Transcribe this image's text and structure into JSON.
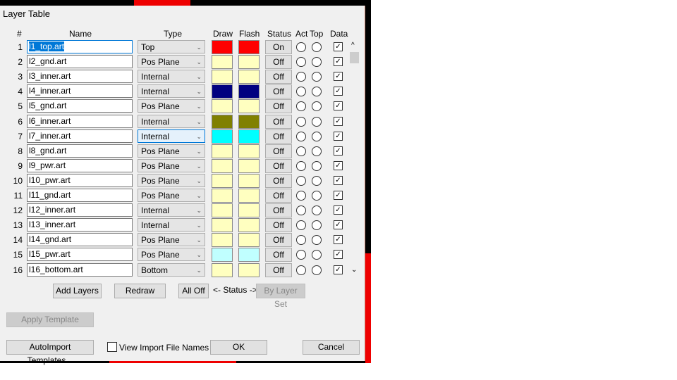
{
  "title": "Layer Table",
  "headers": {
    "num": "#",
    "name": "Name",
    "type": "Type",
    "draw": "Draw",
    "flash": "Flash",
    "status": "Status",
    "act": "Act",
    "top": "Top",
    "data": "Data"
  },
  "layers": [
    {
      "num": "1",
      "name": "l1_top.art",
      "type": "Top",
      "draw": "#ff0000",
      "flash": "#ff0000",
      "status": "On",
      "data": true
    },
    {
      "num": "2",
      "name": "l2_gnd.art",
      "type": "Pos Plane",
      "draw": "#ffffc0",
      "flash": "#ffffc0",
      "status": "Off",
      "data": true
    },
    {
      "num": "3",
      "name": "l3_inner.art",
      "type": "Internal",
      "draw": "#ffffc0",
      "flash": "#ffffc0",
      "status": "Off",
      "data": true
    },
    {
      "num": "4",
      "name": "l4_inner.art",
      "type": "Internal",
      "draw": "#000080",
      "flash": "#000080",
      "status": "Off",
      "data": true
    },
    {
      "num": "5",
      "name": "l5_gnd.art",
      "type": "Pos Plane",
      "draw": "#ffffc0",
      "flash": "#ffffc0",
      "status": "Off",
      "data": true
    },
    {
      "num": "6",
      "name": "l6_inner.art",
      "type": "Internal",
      "draw": "#808000",
      "flash": "#808000",
      "status": "Off",
      "data": true
    },
    {
      "num": "7",
      "name": "l7_inner.art",
      "type": "Internal",
      "draw": "#00ffff",
      "flash": "#00ffff",
      "status": "Off",
      "data": true
    },
    {
      "num": "8",
      "name": "l8_gnd.art",
      "type": "Pos Plane",
      "draw": "#ffffc0",
      "flash": "#ffffc0",
      "status": "Off",
      "data": true
    },
    {
      "num": "9",
      "name": "l9_pwr.art",
      "type": "Pos Plane",
      "draw": "#ffffc0",
      "flash": "#ffffc0",
      "status": "Off",
      "data": true
    },
    {
      "num": "10",
      "name": "l10_pwr.art",
      "type": "Pos Plane",
      "draw": "#ffffc0",
      "flash": "#ffffc0",
      "status": "Off",
      "data": true
    },
    {
      "num": "11",
      "name": "l11_gnd.art",
      "type": "Pos Plane",
      "draw": "#ffffc0",
      "flash": "#ffffc0",
      "status": "Off",
      "data": true
    },
    {
      "num": "12",
      "name": "l12_inner.art",
      "type": "Internal",
      "draw": "#ffffc0",
      "flash": "#ffffc0",
      "status": "Off",
      "data": true
    },
    {
      "num": "13",
      "name": "l13_inner.art",
      "type": "Internal",
      "draw": "#ffffc0",
      "flash": "#ffffc0",
      "status": "Off",
      "data": true
    },
    {
      "num": "14",
      "name": "l14_gnd.art",
      "type": "Pos Plane",
      "draw": "#ffffc0",
      "flash": "#ffffc0",
      "status": "Off",
      "data": true
    },
    {
      "num": "15",
      "name": "l15_pwr.art",
      "type": "Pos Plane",
      "draw": "#c0ffff",
      "flash": "#c0ffff",
      "status": "Off",
      "data": true
    },
    {
      "num": "16",
      "name": "l16_bottom.art",
      "type": "Bottom",
      "draw": "#ffffc0",
      "flash": "#ffffc0",
      "status": "Off",
      "data": true
    }
  ],
  "buttons": {
    "add_layers": "Add Layers",
    "redraw": "Redraw",
    "all_off": "All Off",
    "status_label": "<- Status ->",
    "by_layer_set": "By Layer Set",
    "apply_template": "Apply Template",
    "autoimport": "AutoImport Templates...",
    "view_import": "View Import File Names",
    "ok": "OK",
    "cancel": "Cancel"
  }
}
